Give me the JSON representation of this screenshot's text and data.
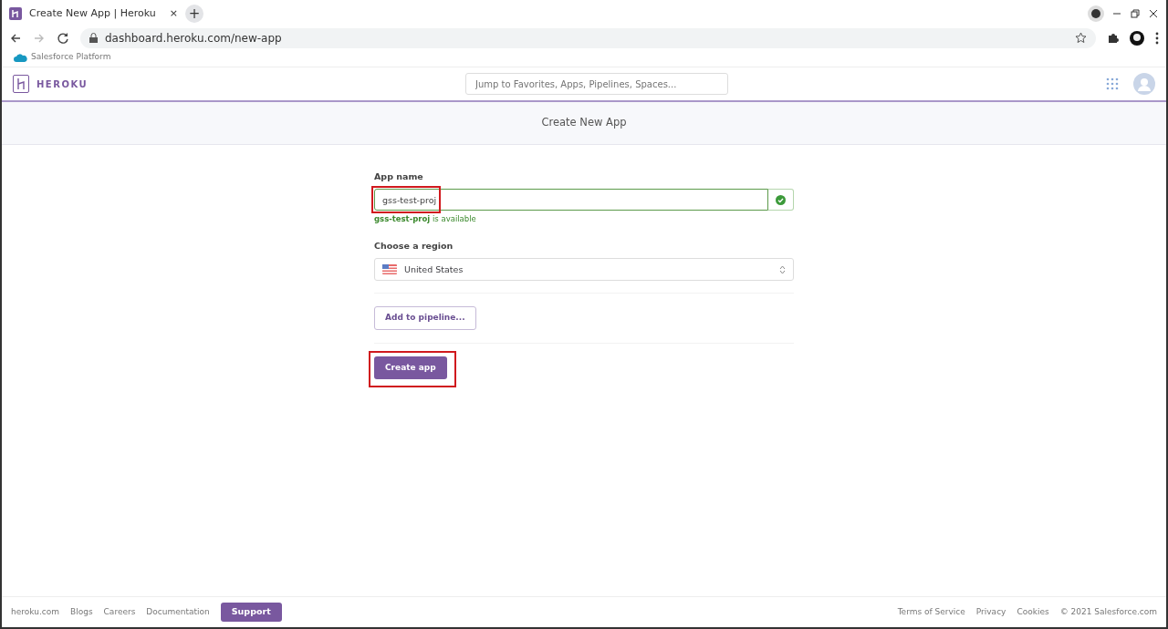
{
  "browser": {
    "tab_title": "Create New App | Heroku",
    "tab_close": "×",
    "new_tab": "+",
    "url": "dashboard.heroku.com/new-app"
  },
  "platform_bar": {
    "label": "Salesforce Platform"
  },
  "header": {
    "brand": "HEROKU",
    "search": {
      "placeholder": "Jump to Favorites, Apps, Pipelines, Spaces..."
    }
  },
  "page_title": "Create New App",
  "form": {
    "app_name": {
      "label": "App name",
      "value": "gss-test-proj",
      "valid": true,
      "highlighted": true,
      "status_name": "gss-test-proj",
      "status_text": " is available"
    },
    "region": {
      "label": "Choose a region",
      "value": "United States"
    },
    "pipeline_button": "Add to pipeline...",
    "create_button": {
      "label": "Create app",
      "highlighted": true
    }
  },
  "footer": {
    "links": [
      "heroku.com",
      "Blogs",
      "Careers",
      "Documentation"
    ],
    "support": "Support",
    "right_links": [
      "Terms of Service",
      "Privacy",
      "Cookies"
    ],
    "copyright": "© 2021 Salesforce.com"
  }
}
